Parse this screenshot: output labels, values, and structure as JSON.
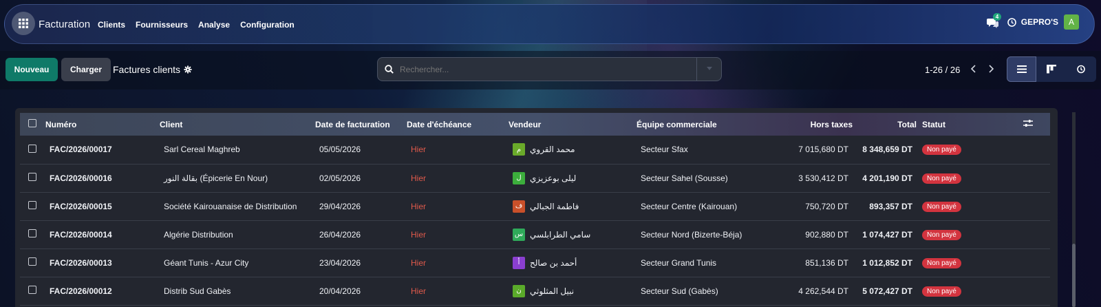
{
  "navbar": {
    "brand": "Facturation",
    "menu": [
      "Clients",
      "Fournisseurs",
      "Analyse",
      "Configuration"
    ],
    "messages_count": "4",
    "company": "GEPRO'S",
    "user_initial": "A"
  },
  "control": {
    "new_label": "Nouveau",
    "load_label": "Charger",
    "breadcrumb": "Factures clients",
    "search_placeholder": "Rechercher...",
    "pager": "1-26 / 26"
  },
  "table": {
    "headers": {
      "numero": "Numéro",
      "client": "Client",
      "date_fact": "Date de facturation",
      "date_ech": "Date d'échéance",
      "vendeur": "Vendeur",
      "equipe": "Équipe commerciale",
      "ht": "Hors taxes",
      "total": "Total",
      "statut": "Statut"
    },
    "rows": [
      {
        "numero": "FAC/2026/00017",
        "client": "Sarl Cereal Maghreb",
        "date": "05/05/2026",
        "echeance": "Hier",
        "vendeur": "محمد القروي",
        "initial": "م",
        "color": "#6aaa2a",
        "equipe": "Secteur Sfax",
        "ht": "7 015,680 DT",
        "total": "8 348,659 DT",
        "statut": "Non payé"
      },
      {
        "numero": "FAC/2026/00016",
        "client": "بقالة النور (Épicerie En Nour)",
        "date": "02/05/2026",
        "echeance": "Hier",
        "vendeur": "ليلى بوعزيزي",
        "initial": "ل",
        "color": "#3cae3c",
        "equipe": "Secteur Sahel (Sousse)",
        "ht": "3 530,412 DT",
        "total": "4 201,190 DT",
        "statut": "Non payé"
      },
      {
        "numero": "FAC/2026/00015",
        "client": "Société Kairouanaise de Distribution",
        "date": "29/04/2026",
        "echeance": "Hier",
        "vendeur": "فاطمة الجبالي",
        "initial": "ف",
        "color": "#c9502a",
        "equipe": "Secteur Centre (Kairouan)",
        "ht": "750,720 DT",
        "total": "893,357 DT",
        "statut": "Non payé"
      },
      {
        "numero": "FAC/2026/00014",
        "client": "Algérie Distribution",
        "date": "26/04/2026",
        "echeance": "Hier",
        "vendeur": "سامي الطرابلسي",
        "initial": "س",
        "color": "#2faa5a",
        "equipe": "Secteur Nord (Bizerte-Béja)",
        "ht": "902,880 DT",
        "total": "1 074,427 DT",
        "statut": "Non payé"
      },
      {
        "numero": "FAC/2026/00013",
        "client": "Géant Tunis - Azur City",
        "date": "23/04/2026",
        "echeance": "Hier",
        "vendeur": "أحمد بن صالح",
        "initial": "أ",
        "color": "#8a3fd0",
        "equipe": "Secteur Grand Tunis",
        "ht": "851,136 DT",
        "total": "1 012,852 DT",
        "statut": "Non payé"
      },
      {
        "numero": "FAC/2026/00012",
        "client": "Distrib Sud Gabès",
        "date": "20/04/2026",
        "echeance": "Hier",
        "vendeur": "نبيل المثلوثي",
        "initial": "ن",
        "color": "#5aaa2a",
        "equipe": "Secteur Sud (Gabès)",
        "ht": "4 262,544 DT",
        "total": "5 072,427 DT",
        "statut": "Non payé"
      }
    ]
  },
  "icons": [
    "apps-grid-icon",
    "chat-icon",
    "clock-icon",
    "gear-icon",
    "search-icon",
    "chevron-left-icon",
    "chevron-right-icon",
    "list-view-icon",
    "kanban-view-icon",
    "activity-view-icon",
    "column-options-icon"
  ]
}
